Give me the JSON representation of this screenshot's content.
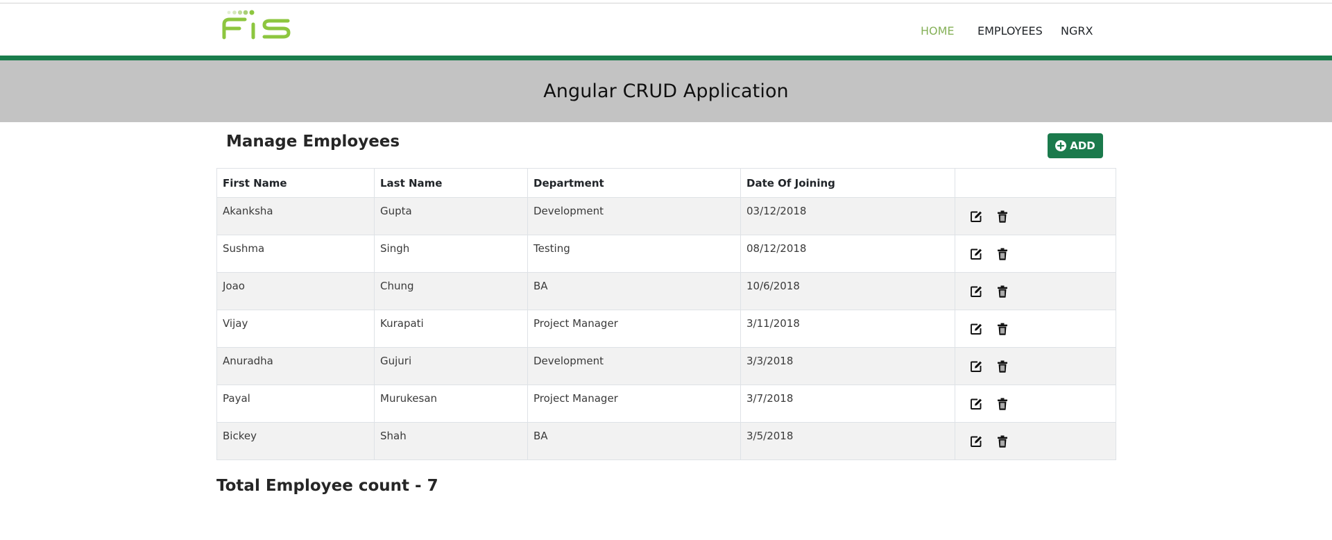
{
  "navbar": {
    "logo_text": "FIS",
    "links": [
      {
        "label": "HOME",
        "active": true
      },
      {
        "label": "EMPLOYEES",
        "active": false
      },
      {
        "label": "NGRX",
        "active": false
      }
    ]
  },
  "banner": {
    "title": "Angular CRUD Application"
  },
  "main": {
    "heading": "Manage Employees",
    "add_label": "ADD",
    "table": {
      "columns": [
        "First Name",
        "Last Name",
        "Department",
        "Date Of Joining",
        ""
      ],
      "rows": [
        [
          "Akanksha",
          "Gupta",
          "Development",
          "03/12/2018"
        ],
        [
          "Sushma",
          "Singh",
          "Testing",
          "08/12/2018"
        ],
        [
          "Joao",
          "Chung",
          "BA",
          "10/6/2018"
        ],
        [
          "Vijay",
          "Kurapati",
          "Project Manager",
          "3/11/2018"
        ],
        [
          "Anuradha",
          "Gujuri",
          "Development",
          "3/3/2018"
        ],
        [
          "Payal",
          "Murukesan",
          "Project Manager",
          "3/7/2018"
        ],
        [
          "Bickey",
          "Shah",
          "BA",
          "3/5/2018"
        ]
      ],
      "row_actions": [
        "edit-icon",
        "trash-icon"
      ]
    },
    "total_text": "Total Employee count - 7"
  },
  "colors": {
    "accent_green": "#1a7d4c",
    "active_nav": "#86b159",
    "banner_bg": "#c3c3c3",
    "logo_green": "#8dc63f"
  }
}
